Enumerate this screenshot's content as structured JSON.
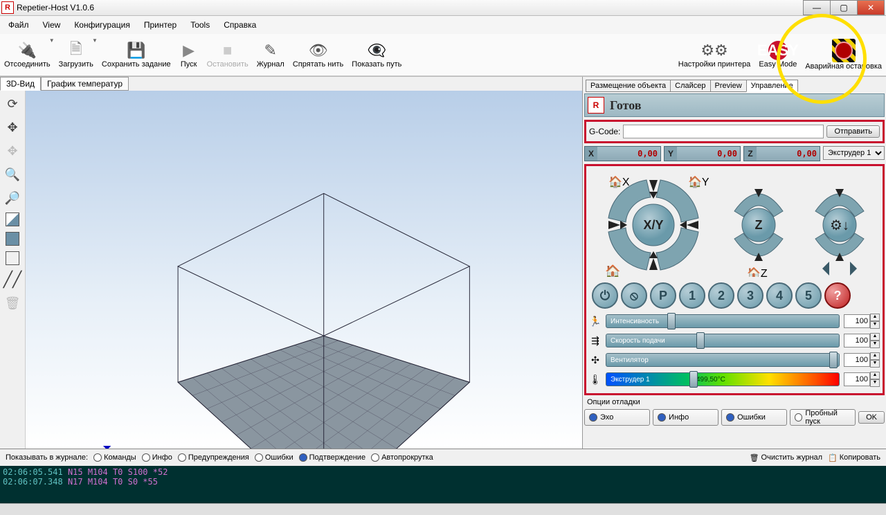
{
  "window": {
    "title": "Repetier-Host V1.0.6"
  },
  "menu": [
    "Файл",
    "View",
    "Конфигурация",
    "Принтер",
    "Tools",
    "Справка"
  ],
  "toolbar": {
    "disconnect": "Отсоединить",
    "load": "Загрузить",
    "save": "Сохранить задание",
    "run": "Пуск",
    "stop": "Остановить",
    "log": "Журнал",
    "hide": "Спрятать нить",
    "showpath": "Показать путь",
    "settings": "Настройки принтера",
    "easy": "Easy Mode",
    "easy_icon": "EASY",
    "estop": "Аварийная остановка"
  },
  "left_tabs": {
    "view3d": "3D-Вид",
    "temp": "График температур"
  },
  "right_tabs": {
    "place": "Размещение объекта",
    "slicer": "Слайсер",
    "preview": "Preview",
    "control": "Управление"
  },
  "control": {
    "status": "Готов",
    "gcode_label": "G-Code:",
    "send": "Отправить",
    "xlabel": "X",
    "ylabel": "Y",
    "zlabel": "Z",
    "xval": "0,00",
    "yval": "0,00",
    "zval": "0,00",
    "extruder_sel": "Экструдер 1",
    "xy_label": "X/Y",
    "z_label": "Z",
    "circle_P": "P",
    "c1": "1",
    "c2": "2",
    "c3": "3",
    "c4": "4",
    "c5": "5",
    "cQ": "?",
    "sliders": {
      "speed": {
        "label": "Интенсивность",
        "val": "100"
      },
      "feed": {
        "label": "Скорость подачи",
        "val": "100"
      },
      "fan": {
        "label": "Вентилятор",
        "val": "100"
      },
      "extr": {
        "label": "Экструдер 1",
        "temp": "499,50°C",
        "val": "100"
      }
    },
    "debug_label": "Опции отладки",
    "debug": {
      "echo": "Эхо",
      "info": "Инфо",
      "errors": "Ошибки",
      "dry": "Пробный пуск",
      "ok": "OK"
    }
  },
  "logfilter": {
    "title": "Показывать в журнале:",
    "cmds": "Команды",
    "info": "Инфо",
    "warn": "Предупреждения",
    "err": "Ошибки",
    "ack": "Подтверждение",
    "auto": "Автопрокрутка",
    "clear": "Очистить журнал",
    "copy": "Копировать"
  },
  "log": [
    {
      "ts": "02:06:05.541",
      "cmd": "N15 M104 T0 S100 *52"
    },
    {
      "ts": "02:06:07.348",
      "cmd": "N17 M104 T0 S0 *55"
    }
  ]
}
